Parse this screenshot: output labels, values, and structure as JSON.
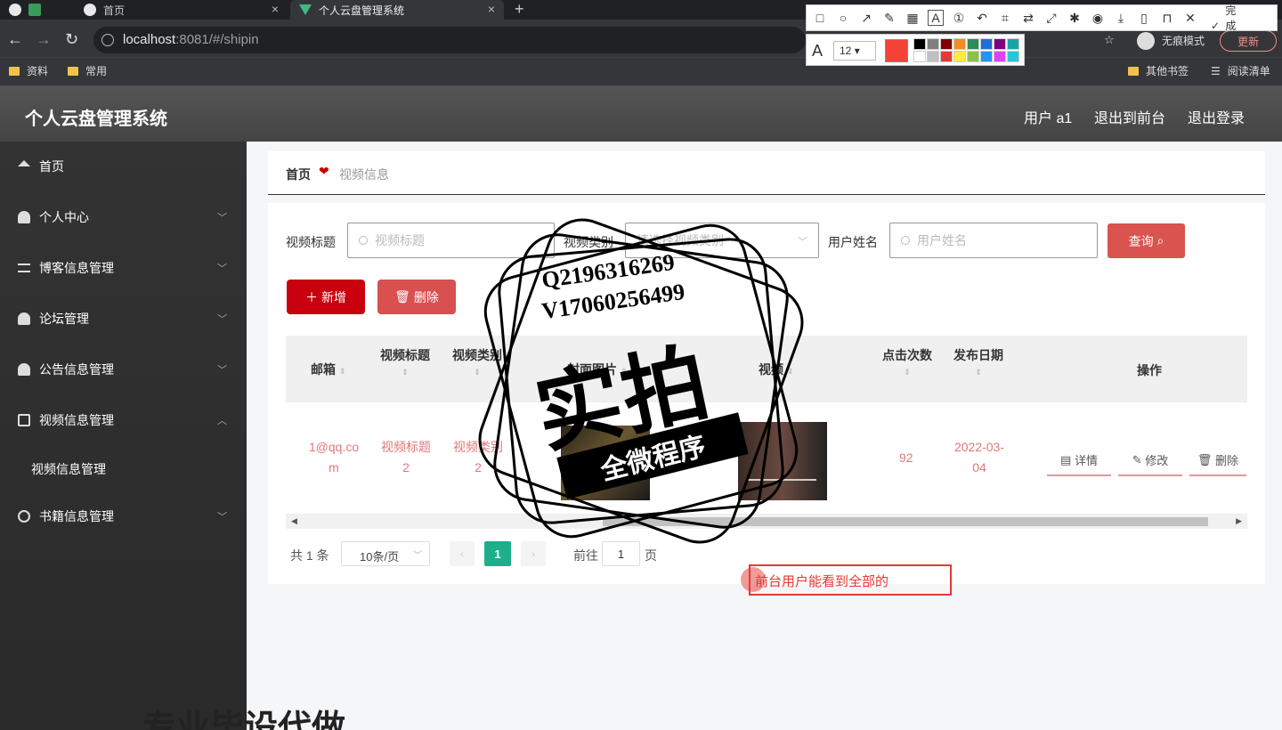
{
  "browser": {
    "tabs": [
      {
        "label": ""
      },
      {
        "label": "首页"
      },
      {
        "label": "个人云盘管理系统"
      }
    ],
    "url_host": "localhost",
    "url_rest": ":8081/#/shipin",
    "bookmarks": [
      "资料",
      "常用",
      "其他书签",
      "阅读清单"
    ],
    "incognito_label": "无痕模式",
    "update_label": "更新"
  },
  "snip_toolbar": {
    "done_label": "完成",
    "font_size": "12",
    "current_color": "#f44336",
    "swatches": [
      "#000000",
      "#808080",
      "#800000",
      "#f28c28",
      "#2e8b57",
      "#1e6fd9",
      "#800080",
      "#1aa5a5",
      "#ffffff",
      "#c0c0c0",
      "#e53935",
      "#ffeb3b",
      "#8bc34a",
      "#2196f3",
      "#e040fb",
      "#26c6da"
    ]
  },
  "header": {
    "title": "个人云盘管理系统",
    "user": "用户 a1",
    "to_front": "退出到前台",
    "logout": "退出登录"
  },
  "sidebar": {
    "items": [
      {
        "label": "首页",
        "icon": "home-icon"
      },
      {
        "label": "个人中心",
        "icon": "user-icon"
      },
      {
        "label": "博客信息管理",
        "icon": "list-icon"
      },
      {
        "label": "论坛管理",
        "icon": "user-icon"
      },
      {
        "label": "公告信息管理",
        "icon": "user-icon"
      },
      {
        "label": "视频信息管理",
        "icon": "box-icon"
      },
      {
        "label": "书籍信息管理",
        "icon": "clock-icon"
      }
    ],
    "sub_item": "视频信息管理"
  },
  "breadcrumb": {
    "home": "首页",
    "current": "视频信息"
  },
  "search": {
    "title_label": "视频标题",
    "title_placeholder": "视频标题",
    "category_label": "视频类别",
    "category_placeholder": "请选择视频类别",
    "user_label": "用户姓名",
    "user_placeholder": "用户姓名",
    "query_label": "查询"
  },
  "actions": {
    "add": "新增",
    "delete": "删除"
  },
  "table": {
    "headers": [
      "邮箱",
      "视频标题",
      "视频类别",
      "封面图片",
      "视频",
      "点击次数",
      "发布日期",
      "操作"
    ],
    "row": {
      "email": "1@qq.com",
      "title": "视频标题2",
      "category": "视频类别2",
      "clicks": "92",
      "date": "2022-03-04"
    },
    "ops": [
      "详情",
      "修改",
      "删除"
    ]
  },
  "pagination": {
    "total": "共 1 条",
    "page_size": "10条/页",
    "current": "1",
    "goto": "前往",
    "goto_value": "1",
    "page_suffix": "页"
  },
  "annotation": "前台用户能看到全部的",
  "watermark": {
    "qq": "Q2196316269",
    "vx": "V17060256499",
    "big": "实拍",
    "band": "全微程序",
    "bottom": "专业毕设代做"
  }
}
